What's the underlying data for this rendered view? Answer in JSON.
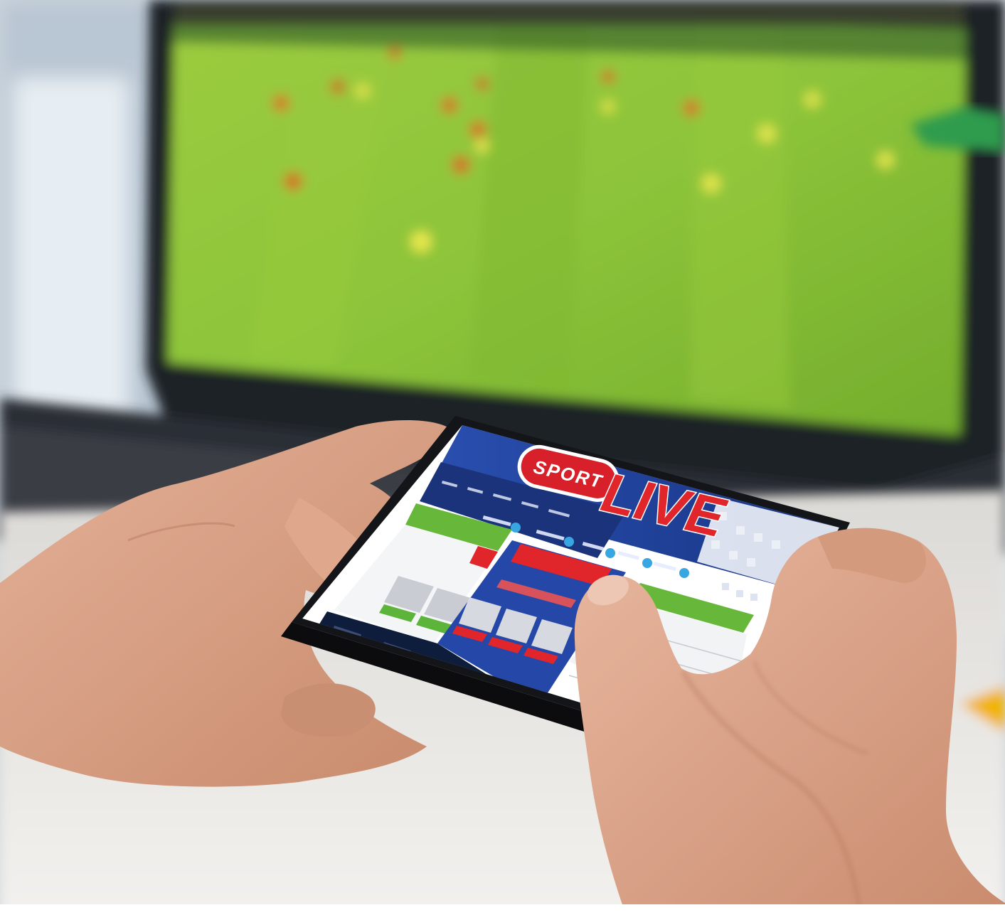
{
  "phone_app": {
    "badge_label": "SPORT",
    "headline": "LIVE"
  },
  "colors": {
    "pitch": "#8cc43a",
    "pitch_dark": "#5f9a22",
    "app_blue": "#1d3f9a",
    "app_red": "#e0252b",
    "app_green": "#67b83a",
    "skin": "#d9a184",
    "table": "#ece8e3"
  }
}
